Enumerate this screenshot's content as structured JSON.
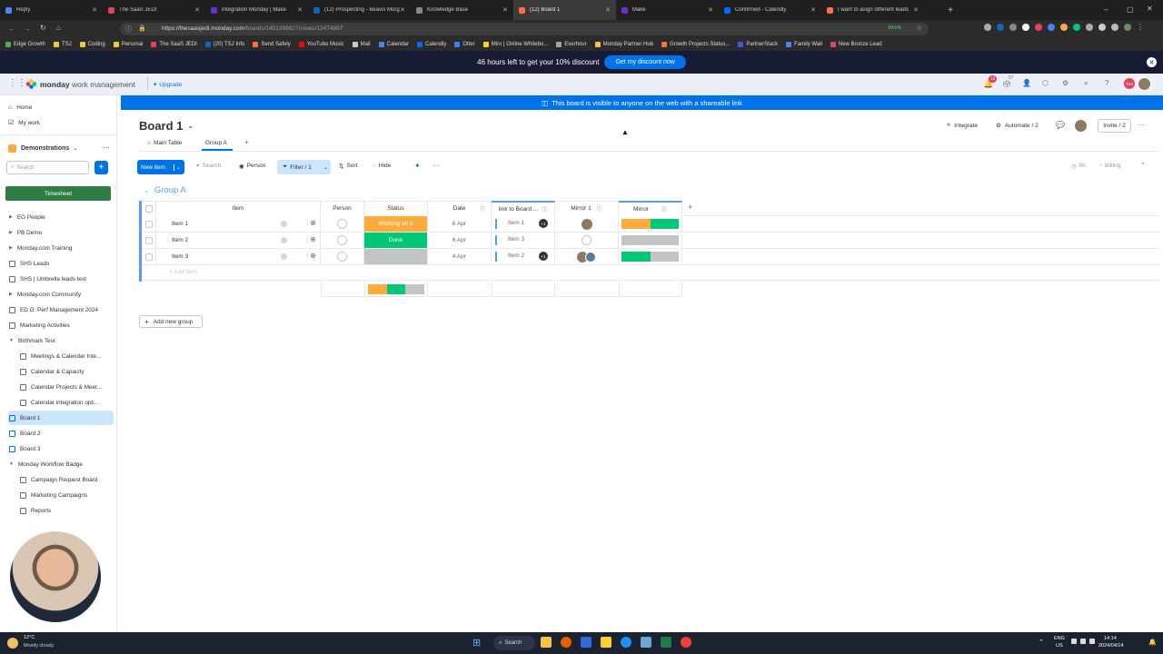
{
  "browser": {
    "tabs": [
      {
        "title": "Reply",
        "color": "#4f86f7"
      },
      {
        "title": "The SaaS JEDI",
        "color": "#e2445c"
      },
      {
        "title": "Integration Monday | Make",
        "color": "#6b2fd1"
      },
      {
        "title": "(12) Prospecting - Beavis Morg",
        "color": "#0a66c2"
      },
      {
        "title": "Knowledge Base",
        "color": "#888888"
      },
      {
        "title": "(12) Board 1",
        "color": "#ff6e3c"
      },
      {
        "title": "Make",
        "color": "#6b2fd1"
      },
      {
        "title": "Confirmed - Calendly",
        "color": "#006bff"
      },
      {
        "title": "I want to asign different leads",
        "color": "#ff6e3c"
      }
    ],
    "url_host": "https://thesaasjedi.monday.com",
    "url_path": "/boards/1451399827/views/13474887",
    "work_label": "Work",
    "bookmarks": [
      {
        "label": "Edge Growth",
        "color": "#4caf50"
      },
      {
        "label": "TSJ",
        "color": "#f4c542"
      },
      {
        "label": "Coding",
        "color": "#f4c542"
      },
      {
        "label": "Personal",
        "color": "#f4c542"
      },
      {
        "label": "The SaaS JEDI",
        "color": "#e2445c"
      },
      {
        "label": "(20) TSJ Info",
        "color": "#0a66c2"
      },
      {
        "label": "Send Safely",
        "color": "#ff6e3c"
      },
      {
        "label": "YouTube Music",
        "color": "#ff0000"
      },
      {
        "label": "Mail",
        "color": "#cccccc"
      },
      {
        "label": "Calendar",
        "color": "#4285f4"
      },
      {
        "label": "Calendly",
        "color": "#006bff"
      },
      {
        "label": "Otter",
        "color": "#3b82f6"
      },
      {
        "label": "Miro | Online Whitebo...",
        "color": "#ffd02f"
      },
      {
        "label": "Everhour",
        "color": "#9ca3af"
      },
      {
        "label": "Monday Partner Hub",
        "color": "#f4c542"
      },
      {
        "label": "Growth Projects Status...",
        "color": "#ff6e3c"
      },
      {
        "label": "PartnerStack",
        "color": "#3b5bdb"
      },
      {
        "label": "Family Wall",
        "color": "#4f86f7"
      },
      {
        "label": "New Bronze Lead",
        "color": "#e2445c"
      }
    ]
  },
  "promo": {
    "text": "46 hours left to get your 10% discount",
    "button": "Get my discount now"
  },
  "header": {
    "brand_bold": "monday",
    "brand_light": "work management",
    "upgrade": "Upgrade",
    "notif_count": "12",
    "inbox_count": "57",
    "avatar_initials": "TSJ"
  },
  "sidebar": {
    "home": "Home",
    "my_work": "My work",
    "workspace": "Demonstrations",
    "search_placeholder": "Search",
    "timesheet": "Timesheet",
    "items": [
      {
        "label": "EG People",
        "type": "folder",
        "indent": 0
      },
      {
        "label": "PB Demo",
        "type": "folder",
        "indent": 0
      },
      {
        "label": "Monday.com Training",
        "type": "folder",
        "indent": 0
      },
      {
        "label": "SHS Leads",
        "type": "board",
        "indent": 0
      },
      {
        "label": "SHS | Umbrella leads test",
        "type": "board",
        "indent": 0
      },
      {
        "label": "Monday.com Community",
        "type": "folder",
        "indent": 0
      },
      {
        "label": "ED G: Perf Management 2024",
        "type": "board",
        "indent": 0
      },
      {
        "label": "Marketing Activities",
        "type": "board",
        "indent": 0
      },
      {
        "label": "Birthmark Test",
        "type": "folder-open",
        "indent": 0
      },
      {
        "label": "Meetings & Calendar Inte...",
        "type": "board",
        "indent": 1
      },
      {
        "label": "Calendar & Capacity",
        "type": "board",
        "indent": 1
      },
      {
        "label": "Calendar Projects & Meet...",
        "type": "board",
        "indent": 1
      },
      {
        "label": "Calendar integration opti...",
        "type": "board",
        "indent": 1
      },
      {
        "label": "Board 1",
        "type": "board-shared",
        "indent": 0,
        "active": true
      },
      {
        "label": "Board 2",
        "type": "board-shared",
        "indent": 0
      },
      {
        "label": "Board 3",
        "type": "board-shared",
        "indent": 0
      },
      {
        "label": "Monday Workflow Badge",
        "type": "folder-open",
        "indent": 0
      },
      {
        "label": "Campaign Request Board",
        "type": "board",
        "indent": 1
      },
      {
        "label": "Marketing Campaigns",
        "type": "board",
        "indent": 1
      },
      {
        "label": "Reports",
        "type": "board",
        "indent": 1
      }
    ]
  },
  "banner": "This board is visible to anyone on the web with a shareable link",
  "board": {
    "title": "Board 1",
    "tabs": [
      "Main Table",
      "Group A"
    ],
    "active_tab": 1,
    "integrate": "Integrate",
    "automate": "Automate / 2",
    "invite": "Invite / 2",
    "toolbar": {
      "new_item": "New item",
      "search": "Search",
      "person": "Person",
      "filter": "Filter / 1",
      "sort": "Sort",
      "hide": "Hide",
      "time": "0h",
      "billing": "Billing"
    },
    "group_name": "Group A",
    "columns": [
      "Item",
      "Person",
      "Status",
      "Date",
      "link to Board ...",
      "Mirror 1",
      "Mirror"
    ],
    "rows": [
      {
        "item": "Item 1",
        "status": "Working on it",
        "status_color": "#fdab3d",
        "date": "6 Apr",
        "link": "Item 1",
        "link_extra": "+1",
        "mirror_split": [
          0.5,
          0.5
        ]
      },
      {
        "item": "Item 2",
        "status": "Done",
        "status_color": "#00c875",
        "date": "6 Apr",
        "link": "Item 3",
        "link_extra": "",
        "mirror_split": [
          0,
          0
        ]
      },
      {
        "item": "Item 3",
        "status": "",
        "status_color": "#c4c4c4",
        "date": "4 Apr",
        "link": "Item 2",
        "link_extra": "+1",
        "mirror_split": [
          0,
          0.5
        ]
      }
    ],
    "add_item": "+ Add item",
    "add_group": "Add new group"
  },
  "taskbar": {
    "temp": "12°C",
    "weather": "Mostly cloudy",
    "search": "Search",
    "lang": "ENG",
    "region": "US",
    "time": "14:14",
    "date": "2024/04/14"
  },
  "colors": {
    "primary": "#0073ea",
    "working": "#fdab3d",
    "done": "#00c875",
    "empty": "#c4c4c4",
    "group": "#579bfc"
  }
}
